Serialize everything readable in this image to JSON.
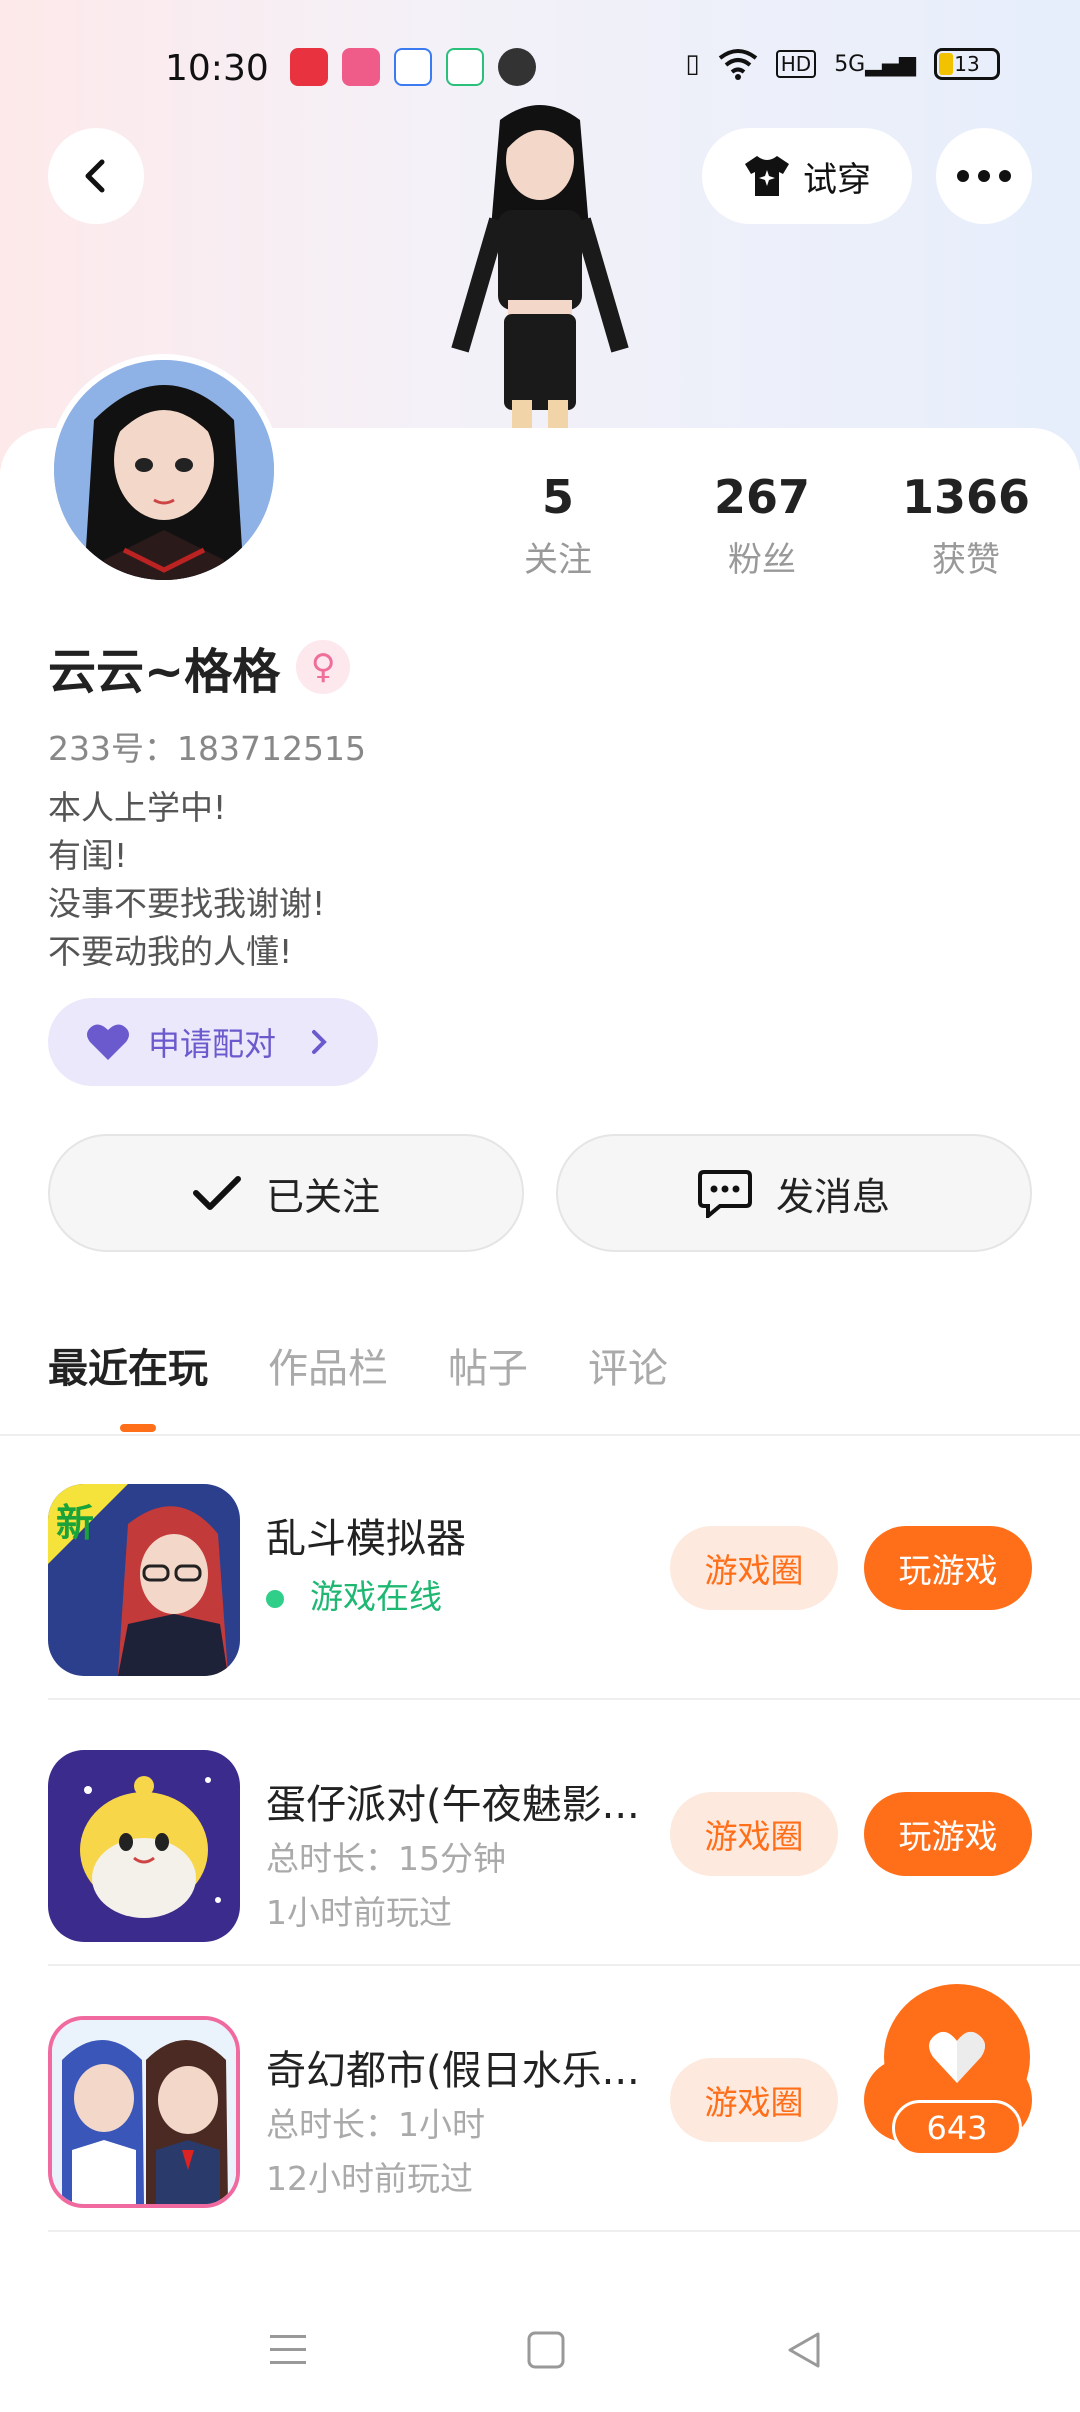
{
  "status_bar": {
    "time": "10:30",
    "notification_icons": [
      "xiaohongshu-icon",
      "app-icon",
      "app-icon",
      "video-icon",
      "wechat-icon"
    ],
    "network": "5G",
    "hd": "HD",
    "battery": "13"
  },
  "header": {
    "tryon_label": "试穿"
  },
  "profile": {
    "stats": [
      {
        "value": "5",
        "label": "关注"
      },
      {
        "value": "267",
        "label": "粉丝"
      },
      {
        "value": "1366",
        "label": "获赞"
      }
    ],
    "nickname": "云云~格格",
    "gender": "female",
    "user_id": "233号：183712515",
    "bio_lines": [
      "本人上学中!",
      "有闺!",
      "没事不要找我谢谢!",
      "不要动我的人懂!"
    ],
    "match_label": "申请配对",
    "follow_label": "已关注",
    "message_label": "发消息"
  },
  "tabs": [
    {
      "label": "最近在玩",
      "active": true
    },
    {
      "label": "作品栏",
      "active": false
    },
    {
      "label": "帖子",
      "active": false
    },
    {
      "label": "评论",
      "active": false
    }
  ],
  "games": [
    {
      "name": "乱斗模拟器",
      "line1": "游戏在线",
      "line2": "",
      "circle": "游戏圈",
      "play": "玩游戏",
      "badge": "新"
    },
    {
      "name": "蛋仔派对(午夜魅影...",
      "line1": "总时长：15分钟",
      "line2": "1小时前玩过",
      "circle": "游戏圈",
      "play": "玩游戏",
      "badge": ""
    },
    {
      "name": "奇幻都市(假日水乐...",
      "line1": "总时长：1小时",
      "line2": "12小时前玩过",
      "circle": "游戏圈",
      "play": "玩游戏",
      "badge": ""
    }
  ],
  "like_fab": {
    "count": "643"
  },
  "colors": {
    "accent": "#ff6f1a",
    "online": "#1fb873",
    "match": "#6a5acd"
  }
}
